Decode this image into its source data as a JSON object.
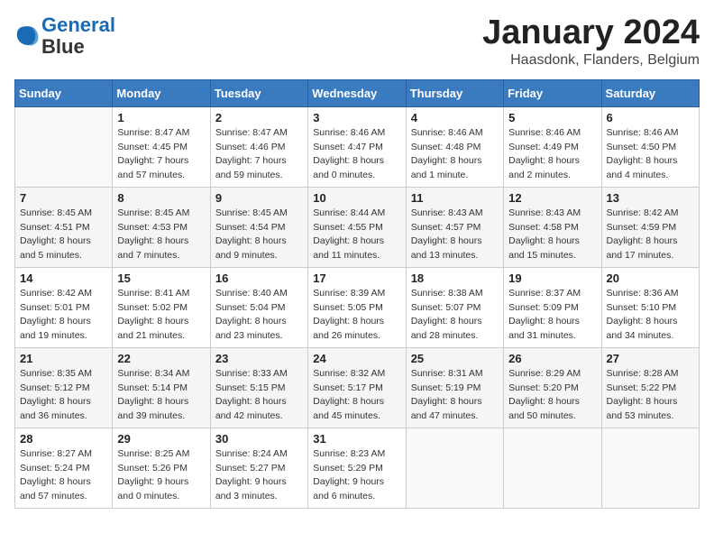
{
  "header": {
    "logo_line1": "General",
    "logo_line2": "Blue",
    "month_title": "January 2024",
    "location": "Haasdonk, Flanders, Belgium"
  },
  "weekdays": [
    "Sunday",
    "Monday",
    "Tuesday",
    "Wednesday",
    "Thursday",
    "Friday",
    "Saturday"
  ],
  "weeks": [
    [
      {
        "day": "",
        "info": ""
      },
      {
        "day": "1",
        "info": "Sunrise: 8:47 AM\nSunset: 4:45 PM\nDaylight: 7 hours\nand 57 minutes."
      },
      {
        "day": "2",
        "info": "Sunrise: 8:47 AM\nSunset: 4:46 PM\nDaylight: 7 hours\nand 59 minutes."
      },
      {
        "day": "3",
        "info": "Sunrise: 8:46 AM\nSunset: 4:47 PM\nDaylight: 8 hours\nand 0 minutes."
      },
      {
        "day": "4",
        "info": "Sunrise: 8:46 AM\nSunset: 4:48 PM\nDaylight: 8 hours\nand 1 minute."
      },
      {
        "day": "5",
        "info": "Sunrise: 8:46 AM\nSunset: 4:49 PM\nDaylight: 8 hours\nand 2 minutes."
      },
      {
        "day": "6",
        "info": "Sunrise: 8:46 AM\nSunset: 4:50 PM\nDaylight: 8 hours\nand 4 minutes."
      }
    ],
    [
      {
        "day": "7",
        "info": "Sunrise: 8:45 AM\nSunset: 4:51 PM\nDaylight: 8 hours\nand 5 minutes."
      },
      {
        "day": "8",
        "info": "Sunrise: 8:45 AM\nSunset: 4:53 PM\nDaylight: 8 hours\nand 7 minutes."
      },
      {
        "day": "9",
        "info": "Sunrise: 8:45 AM\nSunset: 4:54 PM\nDaylight: 8 hours\nand 9 minutes."
      },
      {
        "day": "10",
        "info": "Sunrise: 8:44 AM\nSunset: 4:55 PM\nDaylight: 8 hours\nand 11 minutes."
      },
      {
        "day": "11",
        "info": "Sunrise: 8:43 AM\nSunset: 4:57 PM\nDaylight: 8 hours\nand 13 minutes."
      },
      {
        "day": "12",
        "info": "Sunrise: 8:43 AM\nSunset: 4:58 PM\nDaylight: 8 hours\nand 15 minutes."
      },
      {
        "day": "13",
        "info": "Sunrise: 8:42 AM\nSunset: 4:59 PM\nDaylight: 8 hours\nand 17 minutes."
      }
    ],
    [
      {
        "day": "14",
        "info": "Sunrise: 8:42 AM\nSunset: 5:01 PM\nDaylight: 8 hours\nand 19 minutes."
      },
      {
        "day": "15",
        "info": "Sunrise: 8:41 AM\nSunset: 5:02 PM\nDaylight: 8 hours\nand 21 minutes."
      },
      {
        "day": "16",
        "info": "Sunrise: 8:40 AM\nSunset: 5:04 PM\nDaylight: 8 hours\nand 23 minutes."
      },
      {
        "day": "17",
        "info": "Sunrise: 8:39 AM\nSunset: 5:05 PM\nDaylight: 8 hours\nand 26 minutes."
      },
      {
        "day": "18",
        "info": "Sunrise: 8:38 AM\nSunset: 5:07 PM\nDaylight: 8 hours\nand 28 minutes."
      },
      {
        "day": "19",
        "info": "Sunrise: 8:37 AM\nSunset: 5:09 PM\nDaylight: 8 hours\nand 31 minutes."
      },
      {
        "day": "20",
        "info": "Sunrise: 8:36 AM\nSunset: 5:10 PM\nDaylight: 8 hours\nand 34 minutes."
      }
    ],
    [
      {
        "day": "21",
        "info": "Sunrise: 8:35 AM\nSunset: 5:12 PM\nDaylight: 8 hours\nand 36 minutes."
      },
      {
        "day": "22",
        "info": "Sunrise: 8:34 AM\nSunset: 5:14 PM\nDaylight: 8 hours\nand 39 minutes."
      },
      {
        "day": "23",
        "info": "Sunrise: 8:33 AM\nSunset: 5:15 PM\nDaylight: 8 hours\nand 42 minutes."
      },
      {
        "day": "24",
        "info": "Sunrise: 8:32 AM\nSunset: 5:17 PM\nDaylight: 8 hours\nand 45 minutes."
      },
      {
        "day": "25",
        "info": "Sunrise: 8:31 AM\nSunset: 5:19 PM\nDaylight: 8 hours\nand 47 minutes."
      },
      {
        "day": "26",
        "info": "Sunrise: 8:29 AM\nSunset: 5:20 PM\nDaylight: 8 hours\nand 50 minutes."
      },
      {
        "day": "27",
        "info": "Sunrise: 8:28 AM\nSunset: 5:22 PM\nDaylight: 8 hours\nand 53 minutes."
      }
    ],
    [
      {
        "day": "28",
        "info": "Sunrise: 8:27 AM\nSunset: 5:24 PM\nDaylight: 8 hours\nand 57 minutes."
      },
      {
        "day": "29",
        "info": "Sunrise: 8:25 AM\nSunset: 5:26 PM\nDaylight: 9 hours\nand 0 minutes."
      },
      {
        "day": "30",
        "info": "Sunrise: 8:24 AM\nSunset: 5:27 PM\nDaylight: 9 hours\nand 3 minutes."
      },
      {
        "day": "31",
        "info": "Sunrise: 8:23 AM\nSunset: 5:29 PM\nDaylight: 9 hours\nand 6 minutes."
      },
      {
        "day": "",
        "info": ""
      },
      {
        "day": "",
        "info": ""
      },
      {
        "day": "",
        "info": ""
      }
    ]
  ]
}
